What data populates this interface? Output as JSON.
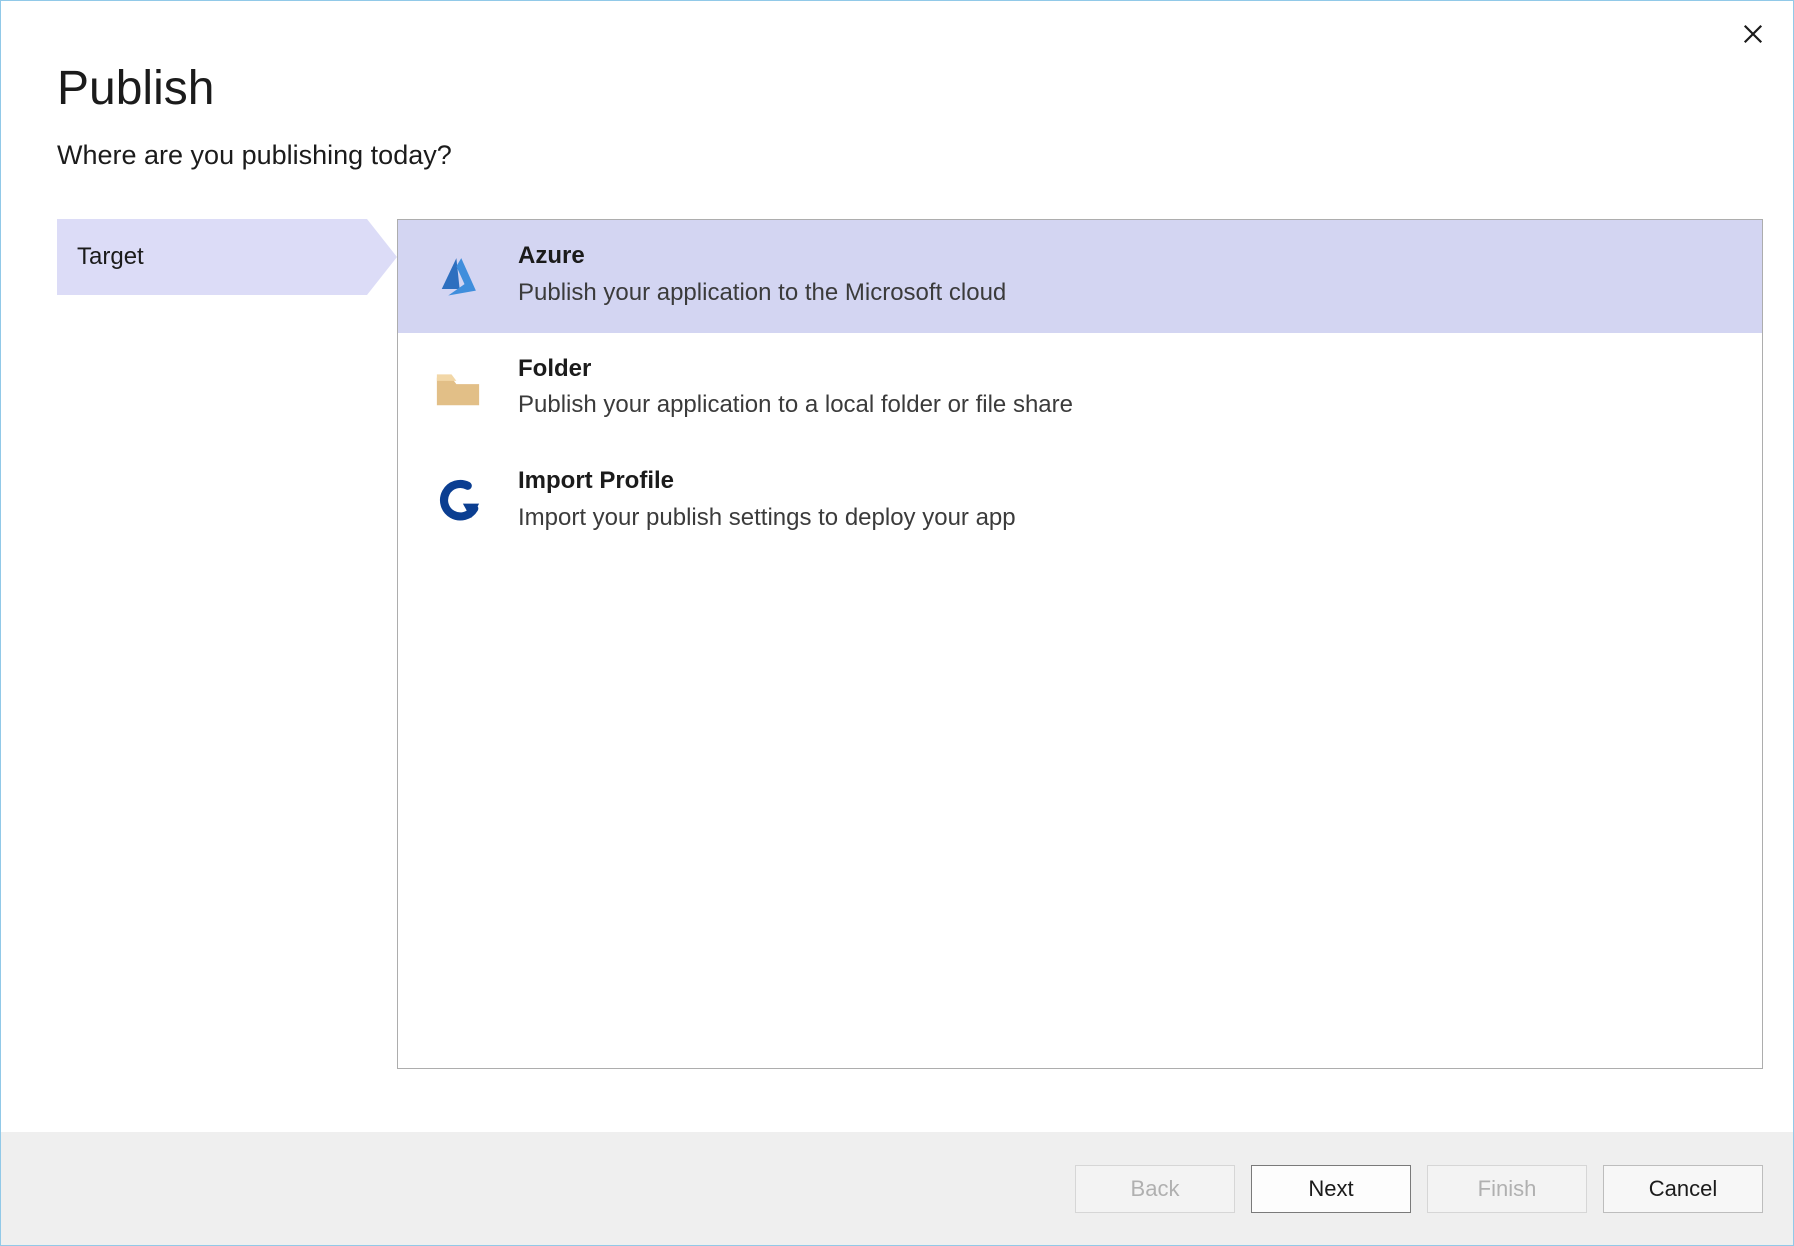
{
  "dialog": {
    "title": "Publish",
    "subtitle": "Where are you publishing today?"
  },
  "steps": {
    "current": "Target"
  },
  "options": [
    {
      "id": "azure",
      "title": "Azure",
      "desc": "Publish your application to the Microsoft cloud",
      "icon": "azure-icon",
      "selected": true
    },
    {
      "id": "folder",
      "title": "Folder",
      "desc": "Publish your application to a local folder or file share",
      "icon": "folder-icon",
      "selected": false
    },
    {
      "id": "import-profile",
      "title": "Import Profile",
      "desc": "Import your publish settings to deploy your app",
      "icon": "import-icon",
      "selected": false
    }
  ],
  "buttons": {
    "back": {
      "label": "Back",
      "enabled": false
    },
    "next": {
      "label": "Next",
      "enabled": true
    },
    "finish": {
      "label": "Finish",
      "enabled": false
    },
    "cancel": {
      "label": "Cancel",
      "enabled": true
    }
  }
}
